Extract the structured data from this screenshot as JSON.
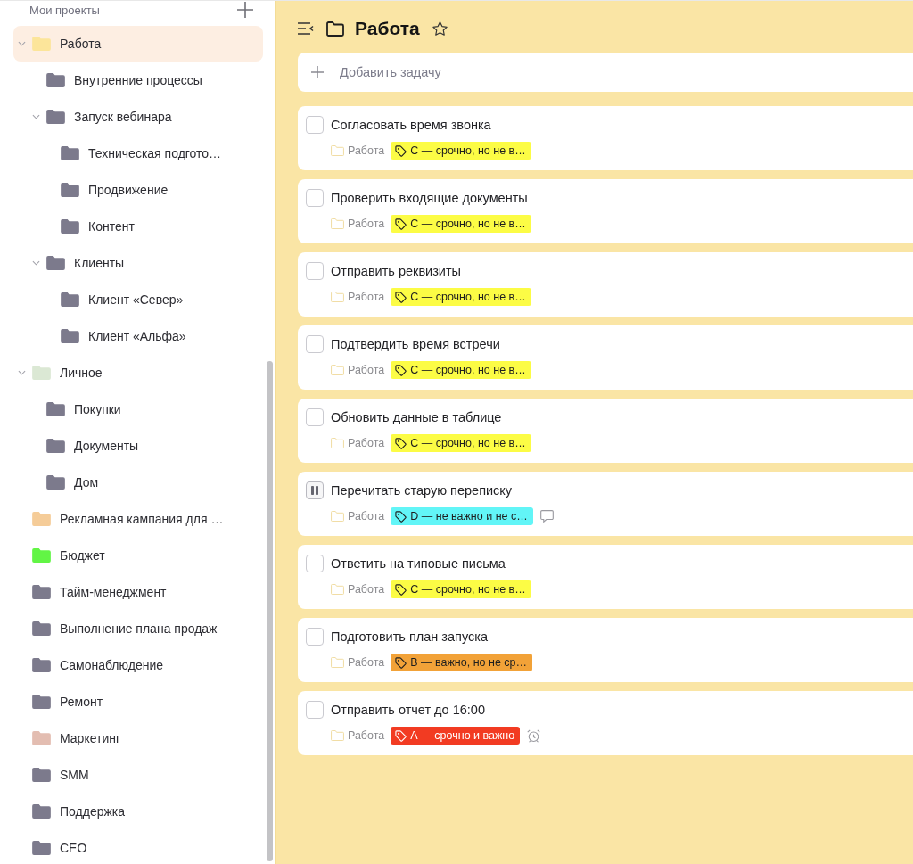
{
  "sidebar": {
    "heading": "Мои проекты",
    "projects": [
      {
        "name": "Работа",
        "color": "#fce59a",
        "selected": true,
        "expanded": true,
        "children": [
          {
            "name": "Внутренние процессы",
            "color": "#7c7a8c",
            "selected": false
          },
          {
            "name": "Запуск вебинара",
            "color": "#7c7a8c",
            "selected": false,
            "expanded": true,
            "children": [
              {
                "name": "Техническая подгото…",
                "color": "#7c7a8c",
                "selected": false
              },
              {
                "name": "Продвижение",
                "color": "#7c7a8c",
                "selected": false
              },
              {
                "name": "Контент",
                "color": "#7c7a8c",
                "selected": false
              }
            ]
          },
          {
            "name": "Клиенты",
            "color": "#7c7a8c",
            "selected": false,
            "expanded": true,
            "children": [
              {
                "name": "Клиент «Север»",
                "color": "#7c7a8c",
                "selected": false
              },
              {
                "name": "Клиент «Альфа»",
                "color": "#7c7a8c",
                "selected": false
              }
            ]
          }
        ]
      },
      {
        "name": "Личное",
        "color": "#dbe8d4",
        "selected": false,
        "expanded": true,
        "children": [
          {
            "name": "Покупки",
            "color": "#7c7a8c",
            "selected": false
          },
          {
            "name": "Документы",
            "color": "#7c7a8c",
            "selected": false
          },
          {
            "name": "Дом",
            "color": "#7c7a8c",
            "selected": false
          }
        ]
      },
      {
        "name": "Рекламная кампания для …",
        "color": "#f5cc98",
        "selected": false
      },
      {
        "name": "Бюджет",
        "color": "#62f545",
        "selected": false
      },
      {
        "name": "Тайм-менеджмент",
        "color": "#7c7a8c",
        "selected": false
      },
      {
        "name": "Выполнение плана продаж",
        "color": "#7c7a8c",
        "selected": false
      },
      {
        "name": "Самонаблюдение",
        "color": "#7c7a8c",
        "selected": false
      },
      {
        "name": "Ремонт",
        "color": "#7c7a8c",
        "selected": false
      },
      {
        "name": "Маркетинг",
        "color": "#e3bdb1",
        "selected": false
      },
      {
        "name": "SMM",
        "color": "#7c7a8c",
        "selected": false
      },
      {
        "name": "Поддержка",
        "color": "#7c7a8c",
        "selected": false
      },
      {
        "name": "CEO",
        "color": "#7c7a8c",
        "selected": false
      }
    ]
  },
  "header": {
    "title": "Работа",
    "favorite": false
  },
  "add_task": {
    "placeholder": "Добавить задачу"
  },
  "tasks": [
    {
      "title": "Согласовать время звонка",
      "project": "Работа",
      "tag": {
        "label": "C — срочно, но не в…",
        "color": "#fcfc45"
      },
      "paused": false,
      "comment": false,
      "reminder": false
    },
    {
      "title": "Проверить входящие документы",
      "project": "Работа",
      "tag": {
        "label": "C — срочно, но не в…",
        "color": "#fcfc45"
      },
      "paused": false,
      "comment": false,
      "reminder": false
    },
    {
      "title": "Отправить реквизиты",
      "project": "Работа",
      "tag": {
        "label": "C — срочно, но не в…",
        "color": "#fcfc45"
      },
      "paused": false,
      "comment": false,
      "reminder": false
    },
    {
      "title": "Подтвердить время встречи",
      "project": "Работа",
      "tag": {
        "label": "C — срочно, но не в…",
        "color": "#fcfc45"
      },
      "paused": false,
      "comment": false,
      "reminder": false
    },
    {
      "title": "Обновить данные в таблице",
      "project": "Работа",
      "tag": {
        "label": "C — срочно, но не в…",
        "color": "#fcfc45"
      },
      "paused": false,
      "comment": false,
      "reminder": false
    },
    {
      "title": "Перечитать старую переписку",
      "project": "Работа",
      "tag": {
        "label": "D — не важно и не с…",
        "color": "#62f5f7"
      },
      "paused": true,
      "comment": true,
      "reminder": false
    },
    {
      "title": "Ответить на типовые письма",
      "project": "Работа",
      "tag": {
        "label": "C — срочно, но не в…",
        "color": "#fcfc45"
      },
      "paused": false,
      "comment": false,
      "reminder": false
    },
    {
      "title": "Подготовить план запуска",
      "project": "Работа",
      "tag": {
        "label": "B — важно, но не ср…",
        "color": "#f2a238"
      },
      "paused": false,
      "comment": false,
      "reminder": false
    },
    {
      "title": "Отправить отчет до 16:00",
      "project": "Работа",
      "tag": {
        "label": "A — срочно и важно",
        "color": "#f23b22"
      },
      "paused": false,
      "comment": false,
      "reminder": true
    }
  ]
}
